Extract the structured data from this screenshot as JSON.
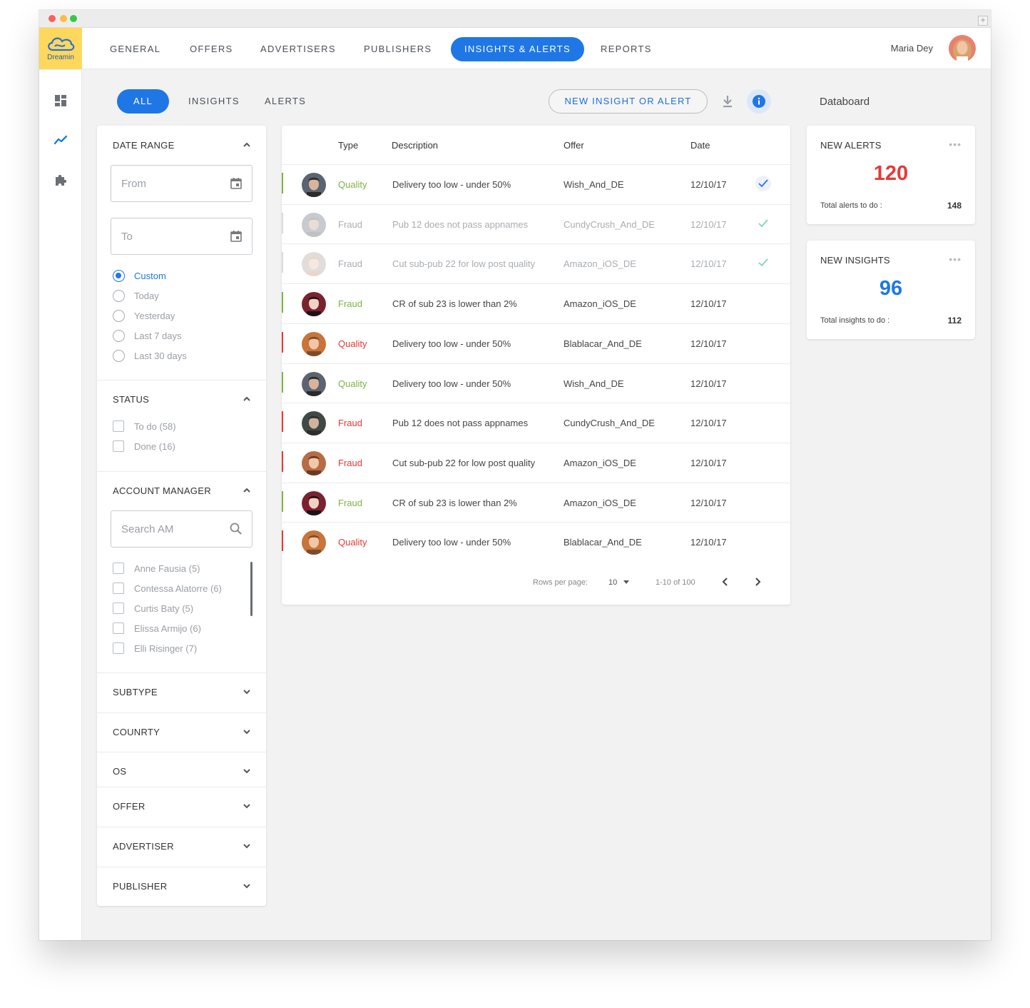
{
  "brand": {
    "name": "Dreamin",
    "color": "#fdd85d",
    "accent": "#1f77e6"
  },
  "nav": {
    "items": [
      {
        "label": "GENERAL"
      },
      {
        "label": "OFFERS"
      },
      {
        "label": "ADVERTISERS"
      },
      {
        "label": "PUBLISHERS"
      },
      {
        "label": "INSIGHTS & ALERTS",
        "active": true
      },
      {
        "label": "REPORTS"
      }
    ],
    "user_name": "Maria Dey"
  },
  "sidebar": {
    "icons": [
      "dashboard-icon",
      "trend-icon",
      "puzzle-icon"
    ],
    "active": "trend-icon"
  },
  "tabs": [
    {
      "label": "ALL",
      "active": true
    },
    {
      "label": "INSIGHTS"
    },
    {
      "label": "ALERTS"
    }
  ],
  "toolbar": {
    "new_label": "NEW INSIGHT OR ALERT",
    "download_icon": "download-icon",
    "info_icon": "info-icon"
  },
  "filters": {
    "date_range": {
      "title": "DATE RANGE",
      "from_placeholder": "From",
      "to_placeholder": "To",
      "options": [
        "Custom",
        "Today",
        "Yesterday",
        "Last 7 days",
        "Last 30 days"
      ],
      "selected": "Custom"
    },
    "status": {
      "title": "STATUS",
      "options": [
        {
          "label": "To do",
          "count": "(58)"
        },
        {
          "label": "Done",
          "count": "(16)"
        }
      ]
    },
    "account_manager": {
      "title": "ACCOUNT MANAGER",
      "search_placeholder": "Search AM",
      "options": [
        {
          "label": "Anne Fausia",
          "count": "(5)"
        },
        {
          "label": "Contessa Alatorre",
          "count": "(6)"
        },
        {
          "label": "Curtis Baty",
          "count": "(5)"
        },
        {
          "label": "Elissa Armijo",
          "count": "(6)"
        },
        {
          "label": "Elli Risinger",
          "count": "(7)"
        }
      ]
    },
    "collapsed": [
      "SUBTYPE",
      "COUNRTY",
      "OS",
      "OFFER",
      "ADVERTISER",
      "PUBLISHER"
    ]
  },
  "table": {
    "columns": [
      "Type",
      "Description",
      "Offer",
      "Date"
    ],
    "rows": [
      {
        "type": "Quality",
        "type_color": "#7cb342",
        "desc": "Delivery too low - under 50%",
        "offer": "Wish_And_DE",
        "date": "12/10/17",
        "done": true,
        "muted": false
      },
      {
        "type": "Fraud",
        "type_color": "#a8acb1",
        "desc": "Pub 12 does not pass appnames",
        "offer": "CundyCrush_And_DE",
        "date": "12/10/17",
        "done": true,
        "muted": true
      },
      {
        "type": "Fraud",
        "type_color": "#a8acb1",
        "desc": "Cut sub-pub 22 for low post quality",
        "offer": "Amazon_iOS_DE",
        "date": "12/10/17",
        "done": true,
        "muted": true
      },
      {
        "type": "Fraud",
        "type_color": "#7cb342",
        "desc": "CR of sub 23 is lower than 2%",
        "offer": "Amazon_iOS_DE",
        "date": "12/10/17",
        "done": false,
        "muted": false
      },
      {
        "type": "Quality",
        "type_color": "#e53935",
        "desc": "Delivery too low - under 50%",
        "offer": "Blablacar_And_DE",
        "date": "12/10/17",
        "done": false,
        "muted": false
      },
      {
        "type": "Quality",
        "type_color": "#7cb342",
        "desc": "Delivery too low - under 50%",
        "offer": "Wish_And_DE",
        "date": "12/10/17",
        "done": false,
        "muted": false
      },
      {
        "type": "Fraud",
        "type_color": "#e53935",
        "desc": "Pub 12 does not pass appnames",
        "offer": "CundyCrush_And_DE",
        "date": "12/10/17",
        "done": false,
        "muted": false
      },
      {
        "type": "Fraud",
        "type_color": "#e53935",
        "desc": "Cut sub-pub 22 for low post quality",
        "offer": "Amazon_iOS_DE",
        "date": "12/10/17",
        "done": false,
        "muted": false
      },
      {
        "type": "Fraud",
        "type_color": "#7cb342",
        "desc": "CR of sub 23 is lower than 2%",
        "offer": "Amazon_iOS_DE",
        "date": "12/10/17",
        "done": false,
        "muted": false
      },
      {
        "type": "Quality",
        "type_color": "#e53935",
        "desc": "Delivery too low - under 50%",
        "offer": "Blablacar_And_DE",
        "date": "12/10/17",
        "done": false,
        "muted": false
      }
    ],
    "pagination": {
      "rows_label": "Rows per page:",
      "rows_value": "10",
      "range": "1-10 of 100"
    }
  },
  "databoard": {
    "title": "Databoard",
    "alerts": {
      "title": "NEW ALERTS",
      "value": "120",
      "value_color": "#e53935",
      "foot_label": "Total alerts to do :",
      "total": "148"
    },
    "insights": {
      "title": "NEW INSIGHTS",
      "value": "96",
      "value_color": "#1f77e6",
      "foot_label": "Total insights to do :",
      "total": "112"
    }
  }
}
